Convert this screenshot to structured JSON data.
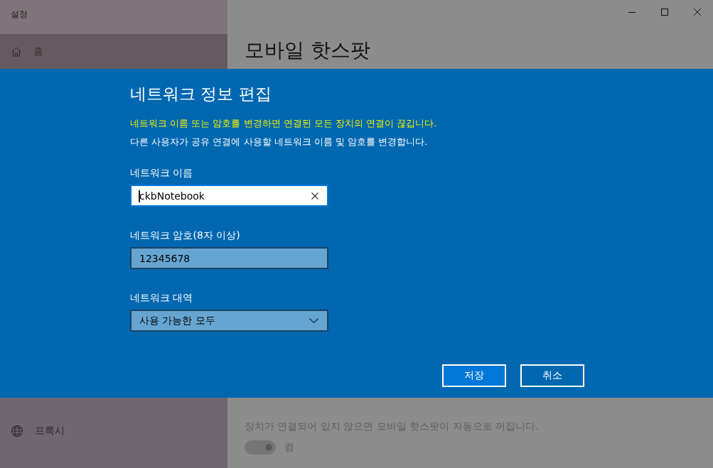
{
  "window": {
    "title": "설정"
  },
  "sidebar": {
    "items": [
      {
        "label": "홈",
        "kind": "home"
      },
      {
        "label": "프록시",
        "kind": "proxy"
      }
    ]
  },
  "page": {
    "title": "모바일 핫스팟",
    "description": "장치가 연결되어 있지 않으면 모바일 핫스팟이 자동으로 꺼집니다.",
    "toggle": {
      "on": true,
      "label": "켬"
    }
  },
  "dialog": {
    "title": "네트워크 정보 편집",
    "warning": "네트워크 이름 또는 암호를 변경하면 연결된 모든 장치의 연결이 끊깁니다.",
    "description": "다른 사용자가 공유 연결에 사용할 네트워크 이름 및 암호를 변경합니다.",
    "fields": [
      {
        "kind": "text",
        "label": "네트워크 이름",
        "value": "ckbNotebook",
        "focused": true
      },
      {
        "kind": "text",
        "label": "네트워크 암호(8자 이상)",
        "value": "12345678",
        "focused": false
      },
      {
        "kind": "select",
        "label": "네트워크 대역",
        "value": "사용 가능한 모두"
      }
    ],
    "buttons": [
      {
        "label": "저장",
        "primary": true
      },
      {
        "label": "취소",
        "primary": false
      }
    ]
  }
}
